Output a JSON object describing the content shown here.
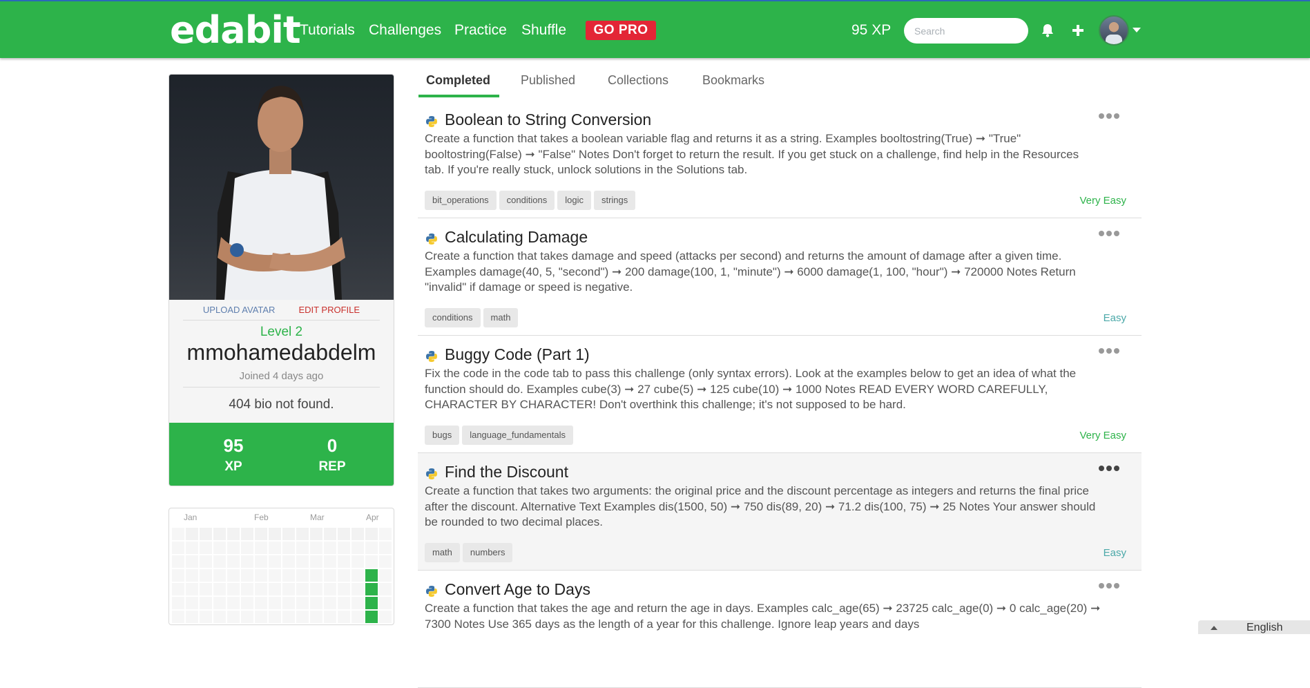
{
  "header": {
    "logo": "edabit",
    "nav": [
      "Tutorials",
      "Challenges",
      "Practice",
      "Shuffle"
    ],
    "go_pro": "GO PRO",
    "xp": "95 XP",
    "search_placeholder": "Search",
    "icons": [
      "bell-icon",
      "plus-icon",
      "user-avatar",
      "caret-down-icon"
    ]
  },
  "profile": {
    "upload_avatar": "UPLOAD AVATAR",
    "edit_profile": "EDIT PROFILE",
    "level": "Level 2",
    "username": "mmohamedabdelm",
    "joined": "Joined 4 days ago",
    "bio": "404 bio not found.",
    "xp_value": "95",
    "xp_label": "XP",
    "rep_value": "0",
    "rep_label": "REP"
  },
  "activity": {
    "months": [
      "Jan",
      "Feb",
      "Mar",
      "Apr"
    ],
    "active_color": "#2db34a",
    "active_cells": [
      [
        14,
        3
      ],
      [
        14,
        4
      ],
      [
        14,
        5
      ],
      [
        14,
        6
      ]
    ]
  },
  "tabs": [
    "Completed",
    "Published",
    "Collections",
    "Bookmarks"
  ],
  "active_tab": "Completed",
  "challenges": [
    {
      "title": "Boolean to String Conversion",
      "desc": "Create a function that takes a boolean variable flag and returns it as a string. Examples booltostring(True) ➞ \"True\" booltostring(False) ➞ \"False\" Notes Don't forget to return the result. If you get stuck on a challenge, find help in the Resources tab. If you're really stuck, unlock solutions in the Solutions tab.",
      "tags": [
        "bit_operations",
        "conditions",
        "logic",
        "strings"
      ],
      "difficulty": "Very Easy",
      "difficulty_color": "#2db34a"
    },
    {
      "title": "Calculating Damage",
      "desc": "Create a function that takes damage and speed (attacks per second) and returns the amount of damage after a given time. Examples damage(40, 5, \"second\") ➞ 200 damage(100, 1, \"minute\") ➞ 6000 damage(1, 100, \"hour\") ➞ 720000 Notes Return \"invalid\" if damage or speed is negative.",
      "tags": [
        "conditions",
        "math"
      ],
      "difficulty": "Easy",
      "difficulty_color": "#4aa8a8"
    },
    {
      "title": "Buggy Code (Part 1)",
      "desc": "Fix the code in the code tab to pass this challenge (only syntax errors). Look at the examples below to get an idea of what the function should do. Examples cube(3) ➞ 27 cube(5) ➞ 125 cube(10) ➞ 1000 Notes READ EVERY WORD CAREFULLY, CHARACTER BY CHARACTER! Don't overthink this challenge; it's not supposed to be hard.",
      "tags": [
        "bugs",
        "language_fundamentals"
      ],
      "difficulty": "Very Easy",
      "difficulty_color": "#2db34a"
    },
    {
      "title": "Find the Discount",
      "desc": "Create a function that takes two arguments: the original price and the discount percentage as integers and returns the final price after the discount. Alternative Text Examples dis(1500, 50) ➞ 750 dis(89, 20) ➞ 71.2 dis(100, 75) ➞ 25 Notes Your answer should be rounded to two decimal places.",
      "tags": [
        "math",
        "numbers"
      ],
      "difficulty": "Easy",
      "difficulty_color": "#4aa8a8"
    },
    {
      "title": "Convert Age to Days",
      "desc": "Create a function that takes the age and return the age in days. Examples calc_age(65) ➞ 23725 calc_age(0) ➞ 0 calc_age(20) ➞ 7300 Notes Use 365 days as the length of a year for this challenge. Ignore leap years and days",
      "tags": [],
      "difficulty": "",
      "difficulty_color": "#2db34a"
    }
  ],
  "footer": {
    "language": "English"
  }
}
